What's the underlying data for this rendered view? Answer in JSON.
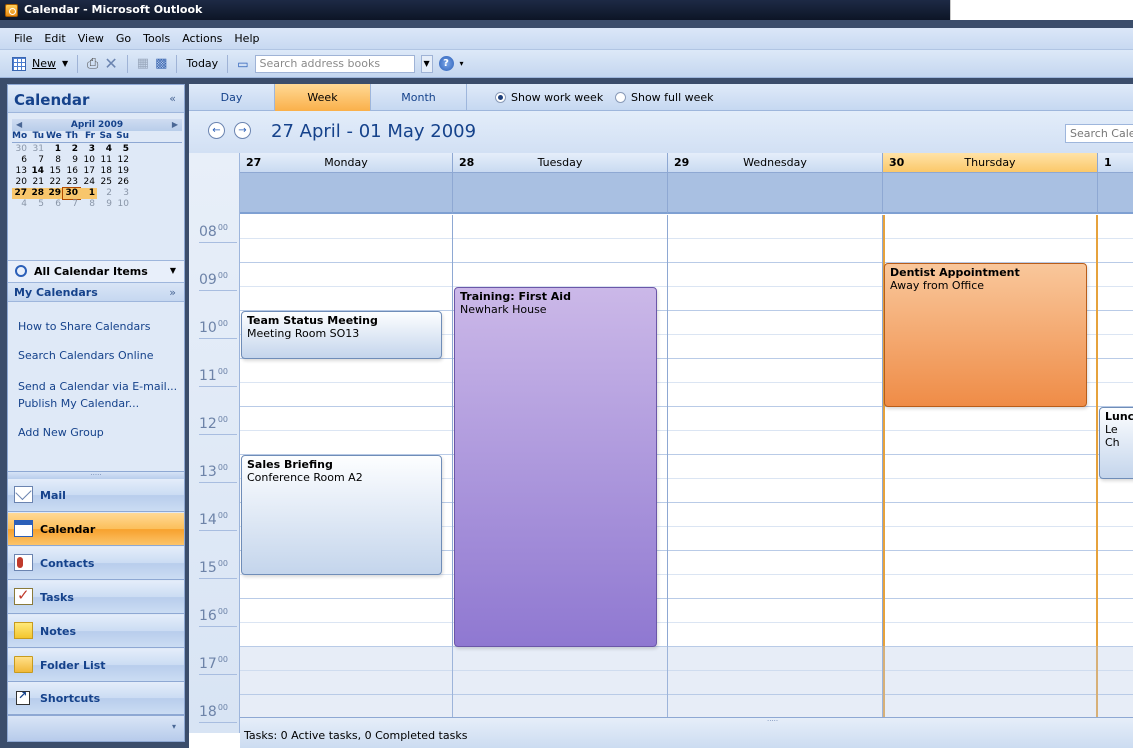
{
  "window": {
    "title": "Calendar - Microsoft Outlook"
  },
  "menu": [
    "File",
    "Edit",
    "View",
    "Go",
    "Tools",
    "Actions",
    "Help"
  ],
  "toolbar": {
    "new_label": "New",
    "today_label": "Today",
    "search_placeholder": "Search address books"
  },
  "nav": {
    "header": "Calendar",
    "collapse_glyph": "«",
    "mini_calendar": {
      "month": "April 2009",
      "dow": [
        "Mo",
        "Tu",
        "We",
        "Th",
        "Fr",
        "Sa",
        "Su"
      ],
      "weeks": [
        [
          "30",
          "31",
          "1",
          "2",
          "3",
          "4",
          "5"
        ],
        [
          "6",
          "7",
          "8",
          "9",
          "10",
          "11",
          "12"
        ],
        [
          "13",
          "14",
          "15",
          "16",
          "17",
          "18",
          "19"
        ],
        [
          "20",
          "21",
          "22",
          "23",
          "24",
          "25",
          "26"
        ],
        [
          "27",
          "28",
          "29",
          "30",
          "1",
          "2",
          "3"
        ],
        [
          "4",
          "5",
          "6",
          "7",
          "8",
          "9",
          "10"
        ]
      ]
    },
    "all_items": "All Calendar Items",
    "my_calendars": "My Calendars",
    "links": [
      "How to Share Calendars",
      "Search Calendars Online",
      "Send a Calendar via E-mail...",
      "Publish My Calendar...",
      "Add New Group"
    ],
    "buttons": [
      "Mail",
      "Calendar",
      "Contacts",
      "Tasks",
      "Notes",
      "Folder List",
      "Shortcuts"
    ],
    "active_button": "Calendar"
  },
  "view": {
    "tabs": [
      "Day",
      "Week",
      "Month"
    ],
    "active_tab": "Week",
    "options": [
      "Show work week",
      "Show full week"
    ],
    "selected_option": "Show work week",
    "date_range": "27 April - 01 May 2009",
    "search_placeholder": "Search Caler"
  },
  "calendar": {
    "days": [
      {
        "num": "27",
        "name": "Monday"
      },
      {
        "num": "28",
        "name": "Tuesday"
      },
      {
        "num": "29",
        "name": "Wednesday"
      },
      {
        "num": "30",
        "name": "Thursday",
        "today": true
      },
      {
        "num": "1",
        "name": ""
      }
    ],
    "hours": [
      "08",
      "09",
      "10",
      "11",
      "12",
      "13",
      "14",
      "15",
      "16",
      "17",
      "18"
    ],
    "minutes": "00",
    "appointments": [
      {
        "title": "Team Status Meeting",
        "location": "Meeting Room SO13",
        "day": 0,
        "start": 10.0,
        "end": 11.0,
        "color": "blue"
      },
      {
        "title": "Sales Briefing",
        "location": "Conference Room A2",
        "day": 0,
        "start": 13.0,
        "end": 15.5,
        "color": "blue"
      },
      {
        "title": "Training: First Aid",
        "location": "Newhark House",
        "day": 1,
        "start": 9.5,
        "end": 17.0,
        "color": "purple"
      },
      {
        "title": "Dentist Appointment",
        "location": "Away from Office",
        "day": 3,
        "start": 9.0,
        "end": 12.0,
        "color": "orange"
      },
      {
        "title": "Lunch",
        "location": "Le Ch",
        "day": 4,
        "start": 12.0,
        "end": 13.5,
        "color": "blue"
      }
    ]
  },
  "status": {
    "tasks": "Tasks: 0 Active tasks, 0 Completed tasks"
  }
}
